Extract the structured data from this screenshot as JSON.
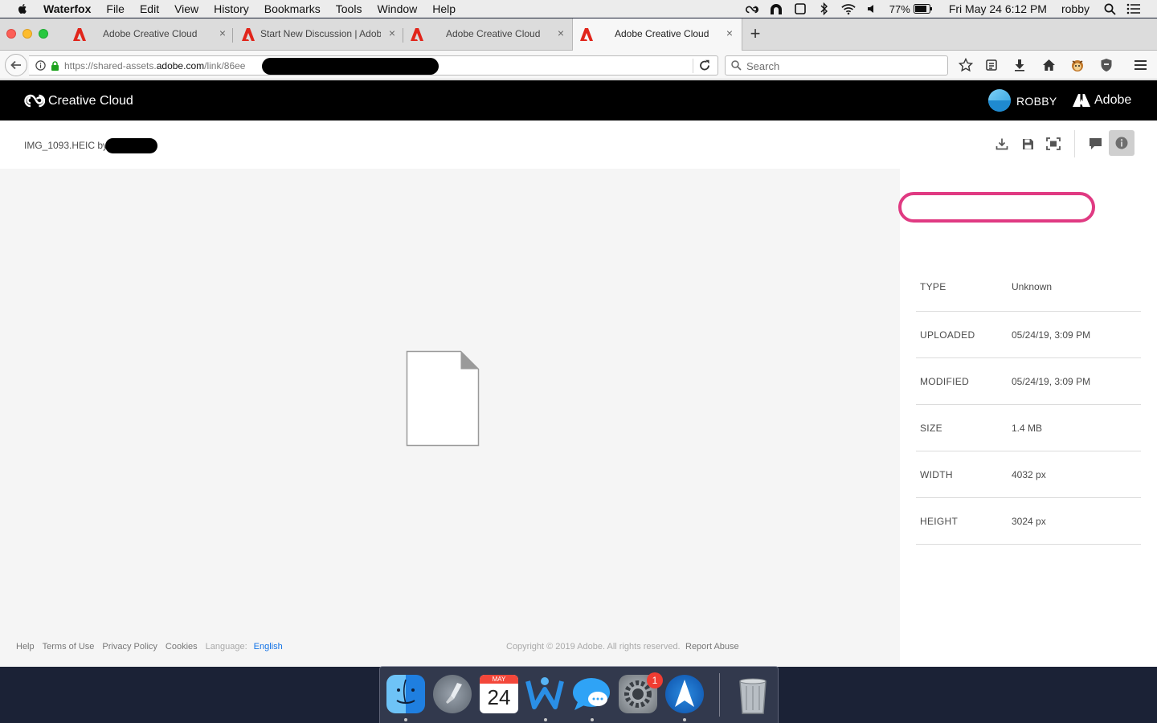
{
  "menubar": {
    "app_name": "Waterfox",
    "items": [
      "File",
      "Edit",
      "View",
      "History",
      "Bookmarks",
      "Tools",
      "Window",
      "Help"
    ],
    "battery": "77%",
    "datetime": "Fri May 24  6:12 PM",
    "user": "robby"
  },
  "browser": {
    "tabs": [
      {
        "title": "Adobe Creative Cloud"
      },
      {
        "title": "Start New Discussion | Adobe"
      },
      {
        "title": "Adobe Creative Cloud"
      },
      {
        "title": "Adobe Creative Cloud"
      }
    ],
    "url": {
      "prefix": "https://shared-assets.",
      "domain": "adobe.com",
      "path": "/link/86ee"
    },
    "search_placeholder": "Search"
  },
  "cc": {
    "brand": "Creative Cloud",
    "username": "ROBBY",
    "adobe": "Adobe",
    "file": {
      "name": "IMG_1093.HEIC by"
    },
    "metadata": [
      {
        "key": "TYPE",
        "value": "Unknown"
      },
      {
        "key": "UPLOADED",
        "value": "05/24/19, 3:09 PM"
      },
      {
        "key": "MODIFIED",
        "value": "05/24/19, 3:09 PM"
      },
      {
        "key": "SIZE",
        "value": "1.4 MB"
      },
      {
        "key": "WIDTH",
        "value": "4032 px"
      },
      {
        "key": "HEIGHT",
        "value": "3024 px"
      }
    ],
    "footer": {
      "links": [
        "Help",
        "Terms of Use",
        "Privacy Policy",
        "Cookies"
      ],
      "language_label": "Language:",
      "language": "English",
      "copyright": "Copyright © 2019 Adobe. All rights reserved.",
      "report": "Report Abuse"
    }
  },
  "dock": {
    "calendar_month": "MAY",
    "calendar_day": "24",
    "badge": "1"
  },
  "colors": {
    "highlight": "#e03a82",
    "link": "#1473e6",
    "header": "#000000"
  }
}
